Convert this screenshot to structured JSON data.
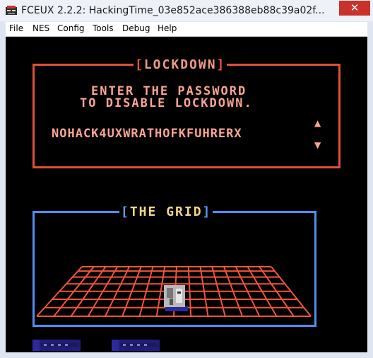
{
  "window": {
    "title": "FCEUX 2.2.2: HackingTime_03e852ace386388eb88c39a02f...",
    "close_glyph": "✕"
  },
  "menu": {
    "items": [
      "File",
      "NES",
      "Config",
      "Tools",
      "Debug",
      "Help"
    ]
  },
  "game": {
    "lockdown_title": "LOCKDOWN",
    "message_line1": "ENTER THE PASSWORD",
    "message_line2": "TO DISABLE LOCKDOWN.",
    "password": "NOHACK4UXWRATHOFKFUHRERX",
    "scroll_up_glyph": "▲",
    "scroll_down_glyph": "▼",
    "grid_title": "THE GRID",
    "colors": {
      "lockdown_border": "#e0503a",
      "text": "#f9a593",
      "grid_border": "#4f8ff0",
      "grid_title": "#f3d68a",
      "grid_lines": "#f0553a"
    }
  }
}
